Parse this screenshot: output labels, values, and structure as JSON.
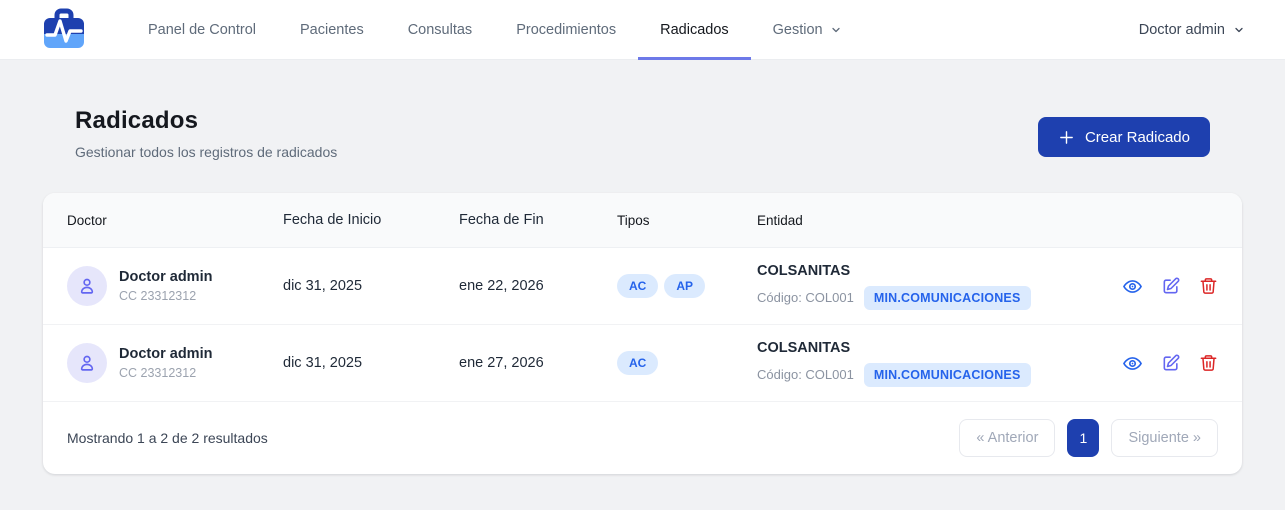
{
  "header": {
    "nav": [
      {
        "label": "Panel de Control",
        "active": false
      },
      {
        "label": "Pacientes",
        "active": false
      },
      {
        "label": "Consultas",
        "active": false
      },
      {
        "label": "Procedimientos",
        "active": false
      },
      {
        "label": "Radicados",
        "active": true
      },
      {
        "label": "Gestion",
        "active": false,
        "has_dropdown": true
      }
    ],
    "user_menu": "Doctor admin"
  },
  "page": {
    "title": "Radicados",
    "subtitle": "Gestionar todos los registros de radicados",
    "create_button": "Crear Radicado"
  },
  "table": {
    "columns": {
      "doctor": "Doctor",
      "fecha_inicio": "Fecha de Inicio",
      "fecha_fin": "Fecha de Fin",
      "tipos": "Tipos",
      "entidad": "Entidad"
    },
    "rows": [
      {
        "doctor_name": "Doctor admin",
        "doctor_id": "CC 23312312",
        "fecha_inicio": "dic 31, 2025",
        "fecha_fin": "ene 22, 2026",
        "tipos": [
          "AC",
          "AP"
        ],
        "entidad": "COLSANITAS",
        "codigo": "Código: COL001",
        "entidad_badge": "MIN.COMUNICACIONES"
      },
      {
        "doctor_name": "Doctor admin",
        "doctor_id": "CC 23312312",
        "fecha_inicio": "dic 31, 2025",
        "fecha_fin": "ene 27, 2026",
        "tipos": [
          "AC"
        ],
        "entidad": "COLSANITAS",
        "codigo": "Código: COL001",
        "entidad_badge": "MIN.COMUNICACIONES"
      }
    ]
  },
  "footer": {
    "results_text": "Mostrando 1 a 2 de 2 resultados",
    "prev_label": "« Anterior",
    "current_page": "1",
    "next_label": "Siguiente »"
  },
  "colors": {
    "accent_blue": "#1e40af",
    "logo_dark": "#1e40af",
    "logo_light": "#60a5fa",
    "active_tab_underline": "#6d79e8",
    "badge_bg": "#dbeafe",
    "badge_text": "#2563eb",
    "avatar_bg": "#e6e6fb",
    "avatar_icon": "#6366f1",
    "view_icon": "#2563eb",
    "edit_icon": "#6366f1",
    "delete_icon": "#dc2626"
  }
}
